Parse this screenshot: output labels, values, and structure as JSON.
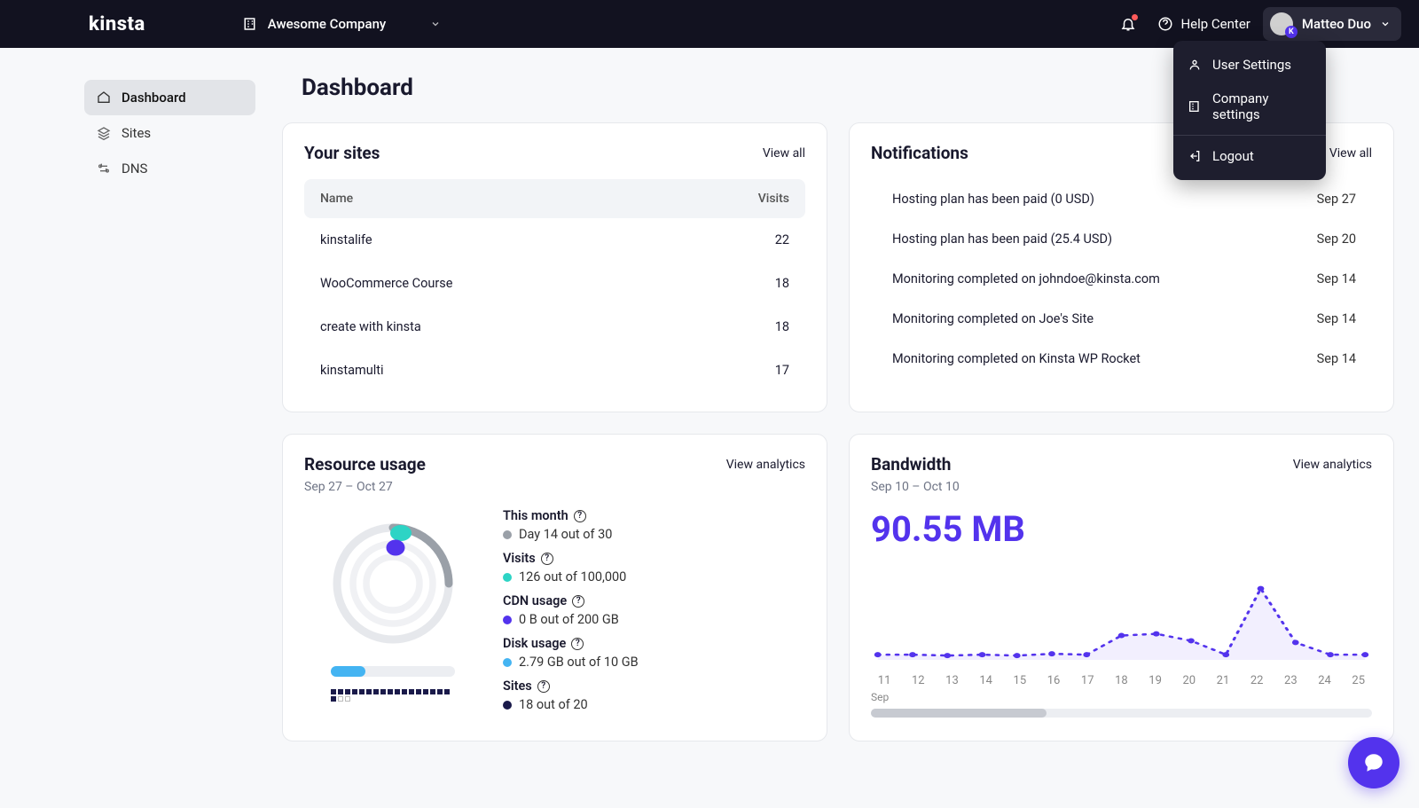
{
  "header": {
    "logo": "kinsta",
    "company": "Awesome Company",
    "help": "Help Center",
    "user": "Matteo Duo"
  },
  "dropdown": {
    "user_settings": "User Settings",
    "company_settings": "Company settings",
    "logout": "Logout"
  },
  "sidebar": {
    "items": [
      {
        "icon": "home",
        "label": "Dashboard",
        "active": true
      },
      {
        "icon": "layers",
        "label": "Sites",
        "active": false
      },
      {
        "icon": "dns",
        "label": "DNS",
        "active": false
      }
    ]
  },
  "page_title": "Dashboard",
  "sites": {
    "title": "Your sites",
    "link": "View all",
    "columns": {
      "name": "Name",
      "visits": "Visits"
    },
    "rows": [
      {
        "name": "kinstalife",
        "visits": "22"
      },
      {
        "name": "WooCommerce Course",
        "visits": "18"
      },
      {
        "name": "create with kinsta",
        "visits": "18"
      },
      {
        "name": "kinstamulti",
        "visits": "17"
      }
    ]
  },
  "notifications": {
    "title": "Notifications",
    "link": "View all",
    "rows": [
      {
        "text": "Hosting plan has been paid (0 USD)",
        "date": "Sep 27"
      },
      {
        "text": "Hosting plan has been paid (25.4 USD)",
        "date": "Sep 20"
      },
      {
        "text": "Monitoring completed on johndoe@kinsta.com",
        "date": "Sep 14"
      },
      {
        "text": "Monitoring completed on Joe's Site",
        "date": "Sep 14"
      },
      {
        "text": "Monitoring completed on Kinsta WP Rocket",
        "date": "Sep 14"
      }
    ]
  },
  "resource": {
    "title": "Resource usage",
    "link": "View analytics",
    "range": "Sep 27 – Oct 27",
    "metrics": {
      "month_label": "This month",
      "month_value": "Day 14 out of 30",
      "visits_label": "Visits",
      "visits_value": "126 out of 100,000",
      "cdn_label": "CDN usage",
      "cdn_value": "0 B out of 200 GB",
      "disk_label": "Disk usage",
      "disk_value": "2.79 GB out of 10 GB",
      "sites_label": "Sites",
      "sites_value": "18 out of 20"
    },
    "colors": {
      "month": "#9aa0a8",
      "visits": "#2dd4c5",
      "cdn": "#5333ed",
      "disk": "#44b4f2",
      "sites": "#1a1a4a"
    }
  },
  "bandwidth": {
    "title": "Bandwidth",
    "link": "View analytics",
    "range": "Sep 10 – Oct 10",
    "value": "90.55 MB",
    "x_month": "Sep"
  },
  "chart_data": {
    "type": "line",
    "title": "Bandwidth",
    "xlabel": "Sep",
    "ylabel": "",
    "x": [
      11,
      12,
      13,
      14,
      15,
      16,
      17,
      18,
      19,
      20,
      21,
      22,
      23,
      24,
      25
    ],
    "values": [
      6,
      6,
      5,
      6,
      5,
      7,
      6,
      28,
      30,
      22,
      6,
      82,
      20,
      6,
      6
    ],
    "ylim": [
      0,
      100
    ],
    "color": "#5333ed"
  }
}
